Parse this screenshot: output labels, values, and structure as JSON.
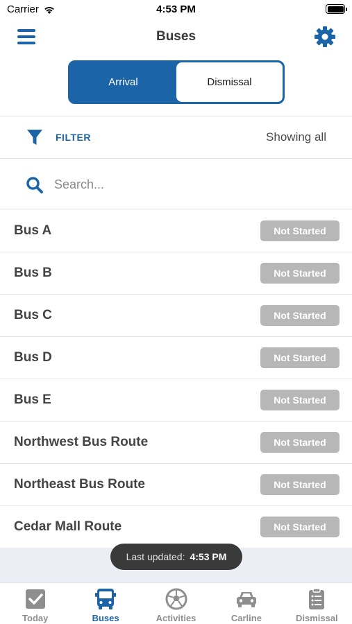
{
  "status_bar": {
    "carrier": "Carrier",
    "time": "4:53 PM"
  },
  "header": {
    "title": "Buses"
  },
  "segments": {
    "arrival": "Arrival",
    "dismissal": "Dismissal",
    "selected": "arrival"
  },
  "filter": {
    "label": "FILTER",
    "showing": "Showing all"
  },
  "search": {
    "placeholder": "Search..."
  },
  "buses": [
    {
      "name": "Bus A",
      "status": "Not Started"
    },
    {
      "name": "Bus B",
      "status": "Not Started"
    },
    {
      "name": "Bus C",
      "status": "Not Started"
    },
    {
      "name": "Bus D",
      "status": "Not Started"
    },
    {
      "name": "Bus E",
      "status": "Not Started"
    },
    {
      "name": "Northwest Bus Route",
      "status": "Not Started"
    },
    {
      "name": "Northeast Bus Route",
      "status": "Not Started"
    },
    {
      "name": "Cedar Mall Route",
      "status": "Not Started"
    }
  ],
  "toast": {
    "label": "Last updated:",
    "time": "4:53 PM"
  },
  "tabs": [
    {
      "label": "Today",
      "icon": "checkbox-icon",
      "active": false
    },
    {
      "label": "Buses",
      "icon": "bus-icon",
      "active": true
    },
    {
      "label": "Activities",
      "icon": "soccer-ball-icon",
      "active": false
    },
    {
      "label": "Carline",
      "icon": "car-icon",
      "active": false
    },
    {
      "label": "Dismissal",
      "icon": "clipboard-icon",
      "active": false
    }
  ],
  "colors": {
    "accent": "#1c64a8",
    "badge": "#b7b7b7",
    "tab_inactive": "#8e8e8e",
    "toast_bg": "#3a3a3a"
  }
}
